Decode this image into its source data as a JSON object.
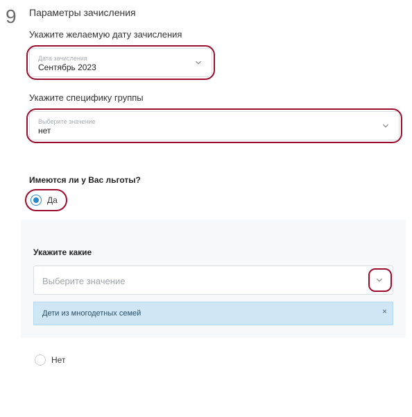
{
  "step": {
    "number": "9",
    "title": "Параметры зачисления"
  },
  "date_field": {
    "label": "Укажите желаемую дату зачисления",
    "floating": "Дата зачисления",
    "value": "Сентябрь 2023"
  },
  "group_field": {
    "label": "Укажите специфику группы",
    "floating": "Выберите значение",
    "value": "нет"
  },
  "benefits": {
    "question": "Имеются ли у Вас льготы?",
    "yes": "Да",
    "no": "Нет",
    "specify_label": "Укажите какие",
    "placeholder": "Выберите значение",
    "selected_tag": "Дети из многодетных семей"
  }
}
